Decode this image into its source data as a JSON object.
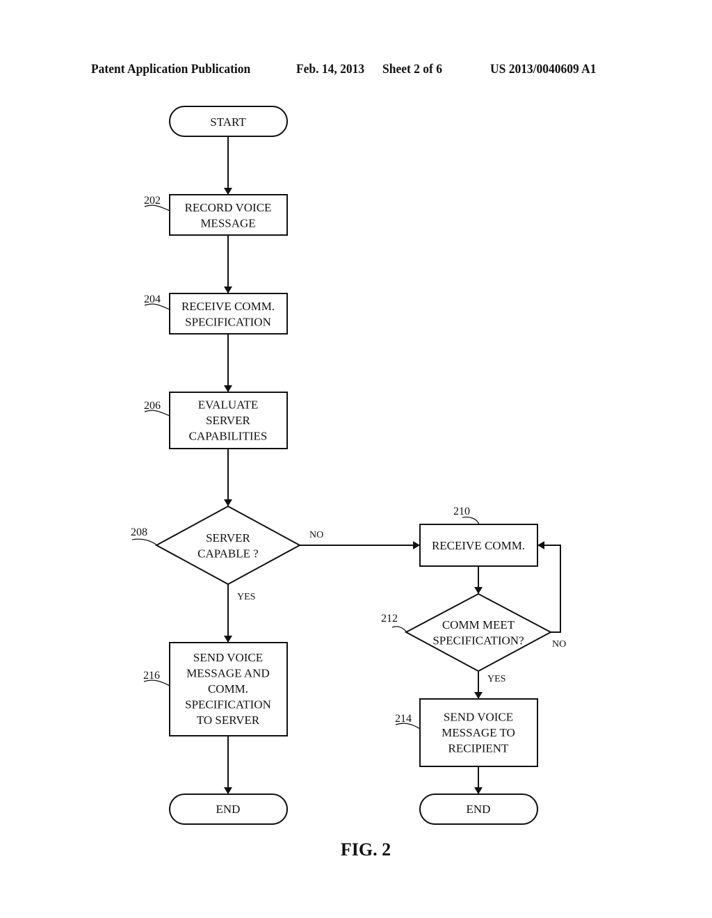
{
  "header": {
    "publication": "Patent Application Publication",
    "date": "Feb. 14, 2013",
    "sheet": "Sheet 2 of 6",
    "number": "US 2013/0040609 A1"
  },
  "figure": {
    "caption": "FIG. 2"
  },
  "nodes": {
    "start": {
      "lines": [
        "START"
      ]
    },
    "n202": {
      "ref": "202",
      "lines": [
        "RECORD VOICE",
        "MESSAGE"
      ]
    },
    "n204": {
      "ref": "204",
      "lines": [
        "RECEIVE COMM.",
        "SPECIFICATION"
      ]
    },
    "n206": {
      "ref": "206",
      "lines": [
        "EVALUATE",
        "SERVER",
        "CAPABILITIES"
      ]
    },
    "n208": {
      "ref": "208",
      "lines": [
        "SERVER",
        "CAPABLE ?"
      ]
    },
    "n210": {
      "ref": "210",
      "lines": [
        "RECEIVE COMM."
      ]
    },
    "n212": {
      "ref": "212",
      "lines": [
        "COMM MEET",
        "SPECIFICATION?"
      ]
    },
    "n214": {
      "ref": "214",
      "lines": [
        "SEND VOICE",
        "MESSAGE TO",
        "RECIPIENT"
      ]
    },
    "n216": {
      "ref": "216",
      "lines": [
        "SEND VOICE",
        "MESSAGE AND",
        "COMM.",
        "SPECIFICATION",
        "TO SERVER"
      ]
    },
    "end_left": {
      "lines": [
        "END"
      ]
    },
    "end_right": {
      "lines": [
        "END"
      ]
    }
  },
  "edges": {
    "e208_no": "NO",
    "e208_yes": "YES",
    "e212_no": "NO",
    "e212_yes": "YES"
  }
}
